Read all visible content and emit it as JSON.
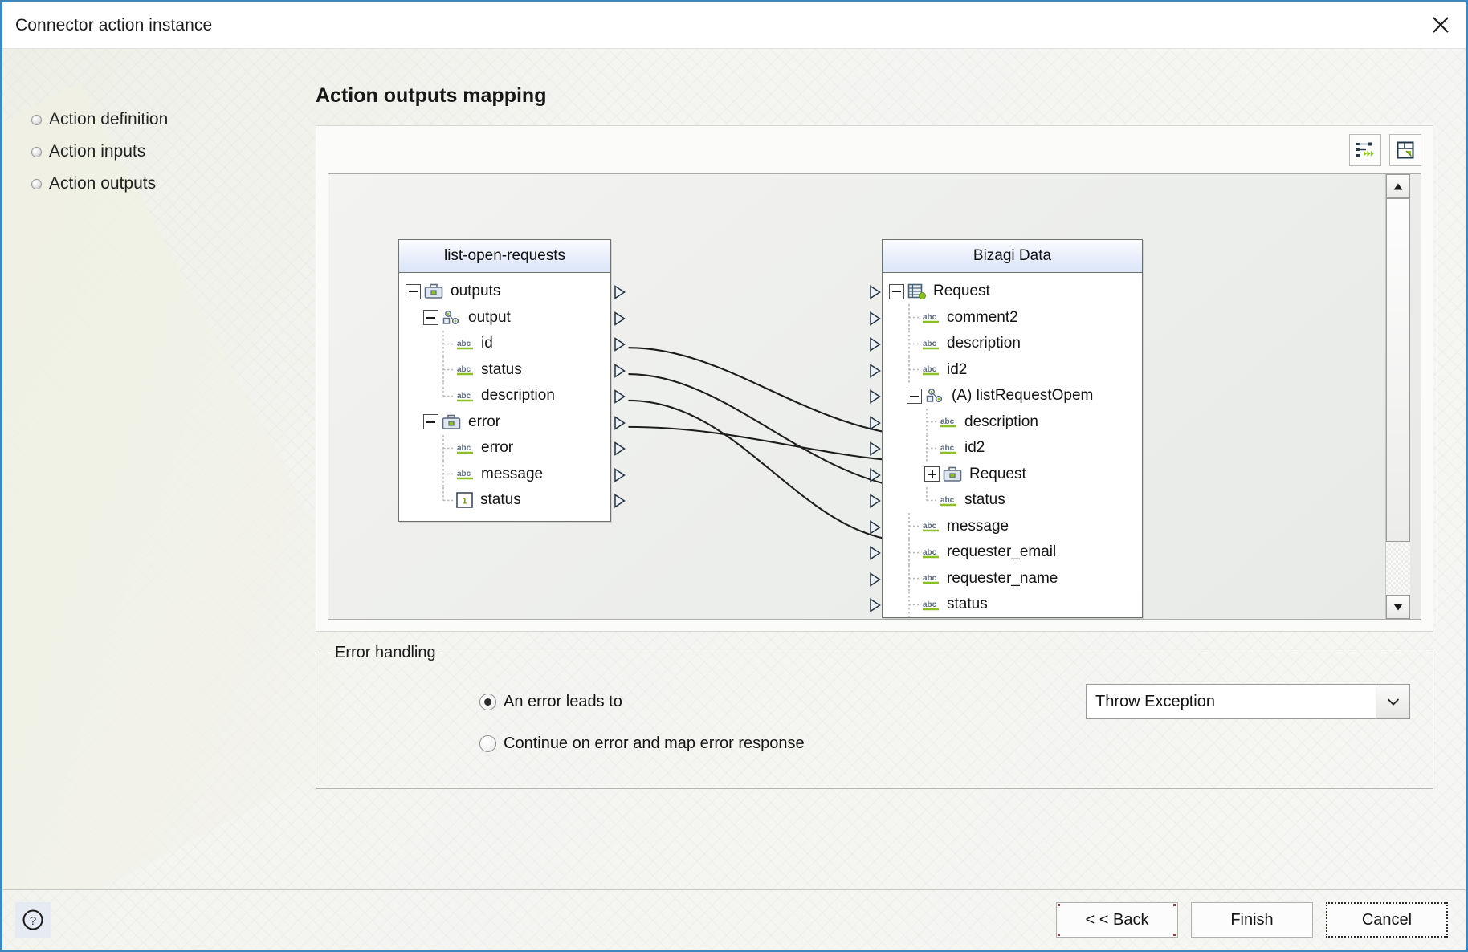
{
  "window": {
    "title": "Connector action instance",
    "close_icon": "close-icon"
  },
  "nav": {
    "items": [
      {
        "label": "Action definition"
      },
      {
        "label": "Action inputs"
      },
      {
        "label": "Action outputs"
      }
    ]
  },
  "main": {
    "page_title": "Action outputs mapping",
    "toolbar": [
      {
        "name": "auto-map-icon",
        "title": "Auto map"
      },
      {
        "name": "expand-icon",
        "title": "Expand"
      }
    ]
  },
  "mapper": {
    "source_panel": {
      "title": "list-open-requests",
      "rows": [
        {
          "label": "outputs",
          "depth": 0,
          "icon": "briefcase",
          "expander": "minus",
          "port": true
        },
        {
          "label": "output",
          "depth": 1,
          "icon": "node",
          "expander": "minus",
          "port": true
        },
        {
          "label": "id",
          "depth": 2,
          "icon": "abc",
          "expander": "none",
          "port": true,
          "dash": "tee"
        },
        {
          "label": "status",
          "depth": 2,
          "icon": "abc",
          "expander": "none",
          "port": true,
          "dash": "tee"
        },
        {
          "label": "description",
          "depth": 2,
          "icon": "abc",
          "expander": "none",
          "port": true,
          "dash": "corner"
        },
        {
          "label": "error",
          "depth": 1,
          "icon": "briefcase",
          "expander": "minus",
          "port": true
        },
        {
          "label": "error",
          "depth": 2,
          "icon": "abc",
          "expander": "none",
          "port": true,
          "dash": "tee"
        },
        {
          "label": "message",
          "depth": 2,
          "icon": "abc",
          "expander": "none",
          "port": true,
          "dash": "tee"
        },
        {
          "label": "status",
          "depth": 2,
          "icon": "num",
          "expander": "none",
          "port": true,
          "dash": "corner"
        }
      ]
    },
    "target_panel": {
      "title": "Bizagi Data",
      "rows": [
        {
          "label": "Request",
          "depth": 0,
          "icon": "entity",
          "expander": "minus",
          "port": true
        },
        {
          "label": "comment2",
          "depth": 1,
          "icon": "abc",
          "expander": "none",
          "port": true,
          "dash": "tee"
        },
        {
          "label": "description",
          "depth": 1,
          "icon": "abc",
          "expander": "none",
          "port": true,
          "dash": "tee"
        },
        {
          "label": "id2",
          "depth": 1,
          "icon": "abc",
          "expander": "none",
          "port": true,
          "dash": "tee"
        },
        {
          "label": "(A) listRequestOpem",
          "depth": 1,
          "icon": "node",
          "expander": "minus",
          "port": true
        },
        {
          "label": "description",
          "depth": 2,
          "icon": "abc",
          "expander": "none",
          "port": true,
          "dash": "tee"
        },
        {
          "label": "id2",
          "depth": 2,
          "icon": "abc",
          "expander": "none",
          "port": true,
          "dash": "tee"
        },
        {
          "label": "Request",
          "depth": 2,
          "icon": "briefcase",
          "expander": "plus",
          "port": true
        },
        {
          "label": "status",
          "depth": 2,
          "icon": "abc",
          "expander": "none",
          "port": true,
          "dash": "corner"
        },
        {
          "label": "message",
          "depth": 1,
          "icon": "abc",
          "expander": "none",
          "port": true,
          "dash": "tee"
        },
        {
          "label": "requester_email",
          "depth": 1,
          "icon": "abc",
          "expander": "none",
          "port": true,
          "dash": "tee"
        },
        {
          "label": "requester_name",
          "depth": 1,
          "icon": "abc",
          "expander": "none",
          "port": true,
          "dash": "tee"
        },
        {
          "label": "status",
          "depth": 1,
          "icon": "abc",
          "expander": "none",
          "port": true,
          "dash": "tee"
        }
      ]
    },
    "links": [
      {
        "from": "output",
        "to": "(A) listRequestOpem"
      },
      {
        "from": "id",
        "to": "id2"
      },
      {
        "from": "status",
        "to": "status"
      },
      {
        "from": "description",
        "to": "description"
      }
    ],
    "scrollbar": {
      "up_icon": "triangle-up-icon",
      "down_icon": "triangle-down-icon"
    }
  },
  "error_handling": {
    "legend": "Error handling",
    "options": [
      {
        "label": "An error leads to",
        "selected": true
      },
      {
        "label": "Continue on error and map error response",
        "selected": false
      }
    ],
    "select": {
      "value": "Throw Exception",
      "arrow_icon": "chevron-down-icon"
    }
  },
  "footer": {
    "help_icon": "help-icon",
    "buttons": [
      {
        "label": "< < Back",
        "style": "corner"
      },
      {
        "label": "Finish",
        "style": "plain"
      },
      {
        "label": "Cancel",
        "style": "dotted"
      }
    ]
  }
}
